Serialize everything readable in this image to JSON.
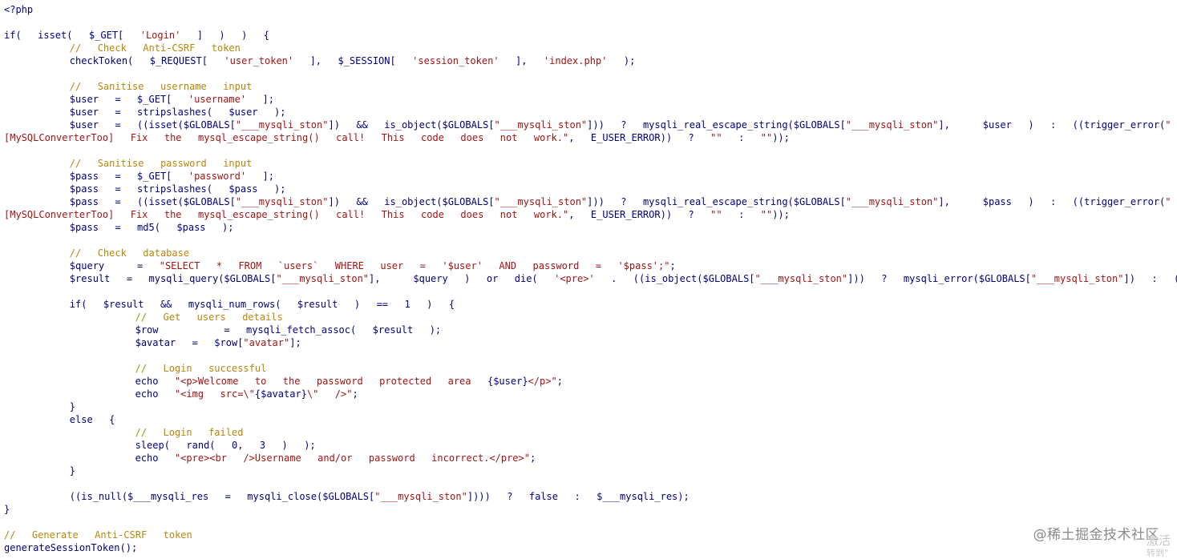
{
  "code_lines": [
    [
      {
        "t": "p",
        "v": "<?php"
      }
    ],
    [],
    [
      {
        "t": "k",
        "v": "if(  isset(  $_GET[  "
      },
      {
        "t": "s",
        "v": "'Login'"
      },
      {
        "t": "k",
        "v": "  ]  )  )  {"
      }
    ],
    [
      {
        "t": "k",
        "v": "        "
      },
      {
        "t": "c",
        "v": "//  Check  Anti-CSRF  token"
      }
    ],
    [
      {
        "t": "k",
        "v": "        checkToken(  $_REQUEST[  "
      },
      {
        "t": "s",
        "v": "'user_token'"
      },
      {
        "t": "k",
        "v": "  ],  $_SESSION[  "
      },
      {
        "t": "s",
        "v": "'session_token'"
      },
      {
        "t": "k",
        "v": "  ],  "
      },
      {
        "t": "s",
        "v": "'index.php'"
      },
      {
        "t": "k",
        "v": "  );"
      }
    ],
    [],
    [
      {
        "t": "k",
        "v": "        "
      },
      {
        "t": "c",
        "v": "//  Sanitise  username  input"
      }
    ],
    [
      {
        "t": "k",
        "v": "        $user  =  $_GET[  "
      },
      {
        "t": "s",
        "v": "'username'"
      },
      {
        "t": "k",
        "v": "  ];"
      }
    ],
    [
      {
        "t": "k",
        "v": "        $user  =  stripslashes(  $user  );"
      }
    ],
    [
      {
        "t": "k",
        "v": "        $user  =  ((isset($GLOBALS["
      },
      {
        "t": "s",
        "v": "\"___mysqli_ston\""
      },
      {
        "t": "k",
        "v": "])  &&  is_object($GLOBALS["
      },
      {
        "t": "s",
        "v": "\"___mysqli_ston\""
      },
      {
        "t": "k",
        "v": "]))  ?  mysqli_real_escape_string($GLOBALS["
      },
      {
        "t": "s",
        "v": "\"___mysqli_ston\""
      },
      {
        "t": "k",
        "v": "],    $user  )  :  ((trigger_error("
      },
      {
        "t": "s",
        "v": "\""
      }
    ],
    [
      {
        "t": "s",
        "v": "[MySQLConverterToo]  Fix  the  mysql_escape_string()  call!  This  code  does  not  work.\""
      },
      {
        "t": "k",
        "v": ",  E_USER_ERROR))  ?  "
      },
      {
        "t": "s",
        "v": "\"\""
      },
      {
        "t": "k",
        "v": "  :  "
      },
      {
        "t": "s",
        "v": "\"\""
      },
      {
        "t": "k",
        "v": "));"
      }
    ],
    [],
    [
      {
        "t": "k",
        "v": "        "
      },
      {
        "t": "c",
        "v": "//  Sanitise  password  input"
      }
    ],
    [
      {
        "t": "k",
        "v": "        $pass  =  $_GET[  "
      },
      {
        "t": "s",
        "v": "'password'"
      },
      {
        "t": "k",
        "v": "  ];"
      }
    ],
    [
      {
        "t": "k",
        "v": "        $pass  =  stripslashes(  $pass  );"
      }
    ],
    [
      {
        "t": "k",
        "v": "        $pass  =  ((isset($GLOBALS["
      },
      {
        "t": "s",
        "v": "\"___mysqli_ston\""
      },
      {
        "t": "k",
        "v": "])  &&  is_object($GLOBALS["
      },
      {
        "t": "s",
        "v": "\"___mysqli_ston\""
      },
      {
        "t": "k",
        "v": "]))  ?  mysqli_real_escape_string($GLOBALS["
      },
      {
        "t": "s",
        "v": "\"___mysqli_ston\""
      },
      {
        "t": "k",
        "v": "],    $pass  )  :  ((trigger_error("
      },
      {
        "t": "s",
        "v": "\""
      }
    ],
    [
      {
        "t": "s",
        "v": "[MySQLConverterToo]  Fix  the  mysql_escape_string()  call!  This  code  does  not  work.\""
      },
      {
        "t": "k",
        "v": ",  E_USER_ERROR))  ?  "
      },
      {
        "t": "s",
        "v": "\"\""
      },
      {
        "t": "k",
        "v": "  :  "
      },
      {
        "t": "s",
        "v": "\"\""
      },
      {
        "t": "k",
        "v": "));"
      }
    ],
    [
      {
        "t": "k",
        "v": "        $pass  =  md5(  $pass  );"
      }
    ],
    [],
    [
      {
        "t": "k",
        "v": "        "
      },
      {
        "t": "c",
        "v": "//  Check  database"
      }
    ],
    [
      {
        "t": "k",
        "v": "        $query    =  "
      },
      {
        "t": "s",
        "v": "\"SELECT  *  FROM  `users`  WHERE  user  =  '$user'  AND  password  =  '$pass';\""
      },
      {
        "t": "k",
        "v": ";"
      }
    ],
    [
      {
        "t": "k",
        "v": "        $result  =  mysqli_query($GLOBALS["
      },
      {
        "t": "s",
        "v": "\"___mysqli_ston\""
      },
      {
        "t": "k",
        "v": "],    $query  )  or  die(  "
      },
      {
        "t": "s",
        "v": "'<pre>'"
      },
      {
        "t": "k",
        "v": "  .  ((is_object($GLOBALS["
      },
      {
        "t": "s",
        "v": "\"___mysqli_ston\""
      },
      {
        "t": "k",
        "v": "]))  ?  mysqli_error($GLOBALS["
      },
      {
        "t": "s",
        "v": "\"___mysqli_ston\""
      },
      {
        "t": "k",
        "v": "])  :  (($___mysqli_res  =  mysq"
      }
    ],
    [],
    [
      {
        "t": "k",
        "v": "        if(  $result  &&  mysqli_num_rows(  $result  )  ==  1  )  {"
      }
    ],
    [
      {
        "t": "k",
        "v": "                "
      },
      {
        "t": "c",
        "v": "//  Get  users  details"
      }
    ],
    [
      {
        "t": "k",
        "v": "                $row        =  mysqli_fetch_assoc(  $result  );"
      }
    ],
    [
      {
        "t": "k",
        "v": "                $avatar  =  $row["
      },
      {
        "t": "s",
        "v": "\"avatar\""
      },
      {
        "t": "k",
        "v": "];"
      }
    ],
    [],
    [
      {
        "t": "k",
        "v": "                "
      },
      {
        "t": "c",
        "v": "//  Login  successful"
      }
    ],
    [
      {
        "t": "k",
        "v": "                echo  "
      },
      {
        "t": "s",
        "v": "\"<p>Welcome  to  the  password  protected  area  "
      },
      {
        "t": "k",
        "v": "{$user}"
      },
      {
        "t": "s",
        "v": "</p>\""
      },
      {
        "t": "k",
        "v": ";"
      }
    ],
    [
      {
        "t": "k",
        "v": "                echo  "
      },
      {
        "t": "s",
        "v": "\"<img  src=\\\""
      },
      {
        "t": "k",
        "v": "{$avatar}"
      },
      {
        "t": "s",
        "v": "\\\"  />\""
      },
      {
        "t": "k",
        "v": ";"
      }
    ],
    [
      {
        "t": "k",
        "v": "        }"
      }
    ],
    [
      {
        "t": "k",
        "v": "        else  {"
      }
    ],
    [
      {
        "t": "k",
        "v": "                "
      },
      {
        "t": "c",
        "v": "//  Login  failed"
      }
    ],
    [
      {
        "t": "k",
        "v": "                sleep(  rand(  0,  3  )  );"
      }
    ],
    [
      {
        "t": "k",
        "v": "                echo  "
      },
      {
        "t": "s",
        "v": "\"<pre><br  />Username  and/or  password  incorrect.</pre>\""
      },
      {
        "t": "k",
        "v": ";"
      }
    ],
    [
      {
        "t": "k",
        "v": "        }"
      }
    ],
    [],
    [
      {
        "t": "k",
        "v": "        ((is_null($___mysqli_res  =  mysqli_close($GLOBALS["
      },
      {
        "t": "s",
        "v": "\"___mysqli_ston\""
      },
      {
        "t": "k",
        "v": "])))  ?  false  :  $___mysqli_res);"
      }
    ],
    [
      {
        "t": "k",
        "v": "}"
      }
    ],
    [],
    [
      {
        "t": "c",
        "v": "//  Generate  Anti-CSRF  token"
      }
    ],
    [
      {
        "t": "k",
        "v": "generateSessionToken();"
      }
    ]
  ],
  "watermark": "@稀土掘金技术社区",
  "activate_line1": "激活",
  "activate_line2": "转到\""
}
